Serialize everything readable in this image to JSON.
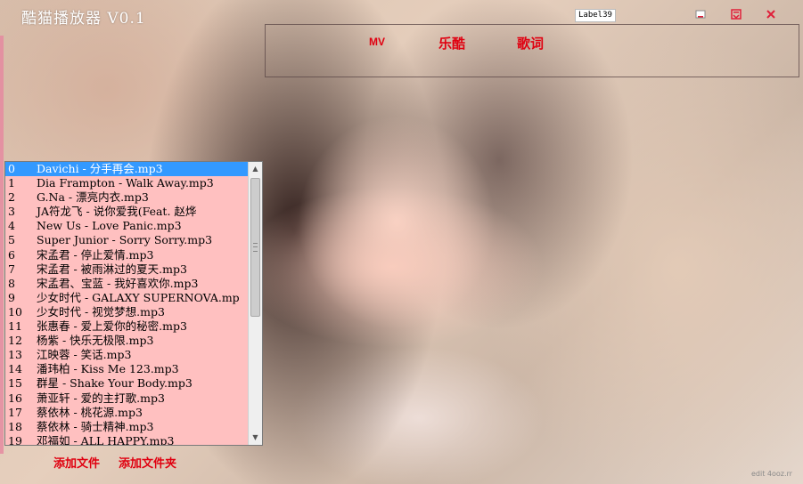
{
  "window": {
    "title": "酷猫播放器 V0.1",
    "label139": "Label39",
    "controls": [
      "minimize",
      "restore",
      "close"
    ]
  },
  "tabs": [
    {
      "label": "MV"
    },
    {
      "label": "乐酷"
    },
    {
      "label": "歌词"
    }
  ],
  "playlist": {
    "selected_index": 0,
    "items": [
      {
        "num": "0",
        "name": "Davichi - 分手再会.mp3"
      },
      {
        "num": "1",
        "name": "Dia Frampton - Walk Away.mp3"
      },
      {
        "num": "2",
        "name": "G.Na - 漂亮内衣.mp3"
      },
      {
        "num": "3",
        "name": "JA符龙飞 - 说你爱我(Feat. 赵烨"
      },
      {
        "num": "4",
        "name": "New Us - Love Panic.mp3"
      },
      {
        "num": "5",
        "name": "Super Junior - Sorry Sorry.mp3"
      },
      {
        "num": "6",
        "name": "宋孟君 - 停止爱情.mp3"
      },
      {
        "num": "7",
        "name": "宋孟君 - 被雨淋过的夏天.mp3"
      },
      {
        "num": "8",
        "name": "宋孟君、宝蓝 - 我好喜欢你.mp3"
      },
      {
        "num": "9",
        "name": "少女时代 - GALAXY SUPERNOVA.mp"
      },
      {
        "num": "10",
        "name": " 少女时代 - 视觉梦想.mp3"
      },
      {
        "num": "11",
        "name": " 张惠春 - 爱上爱你的秘密.mp3"
      },
      {
        "num": "12",
        "name": " 杨紫 - 快乐无极限.mp3"
      },
      {
        "num": "13",
        "name": " 江映蓉 - 笑话.mp3"
      },
      {
        "num": "14",
        "name": " 潘玮柏 - Kiss Me 123.mp3"
      },
      {
        "num": "15",
        "name": " 群星 - Shake Your Body.mp3"
      },
      {
        "num": "16",
        "name": " 萧亚轩 - 爱的主打歌.mp3"
      },
      {
        "num": "17",
        "name": " 蔡依林 - 桃花源.mp3"
      },
      {
        "num": "18",
        "name": " 蔡依林 - 骑士精神.mp3"
      },
      {
        "num": "19",
        "name": " 邓福如 - ALL HAPPY.mp3"
      }
    ]
  },
  "actions": {
    "add_file": "添加文件",
    "add_folder": "添加文件夹"
  },
  "watermark": "edit 4ooz.rr",
  "colors": {
    "accent_red": "#e00010",
    "playlist_bg": "#ffc0c0",
    "selection": "#3399ff"
  },
  "icons": {
    "minimize": "minimize-icon",
    "restore": "restore-icon",
    "close": "close-icon",
    "scroll_up": "arrow-up-icon",
    "scroll_down": "arrow-down-icon"
  }
}
